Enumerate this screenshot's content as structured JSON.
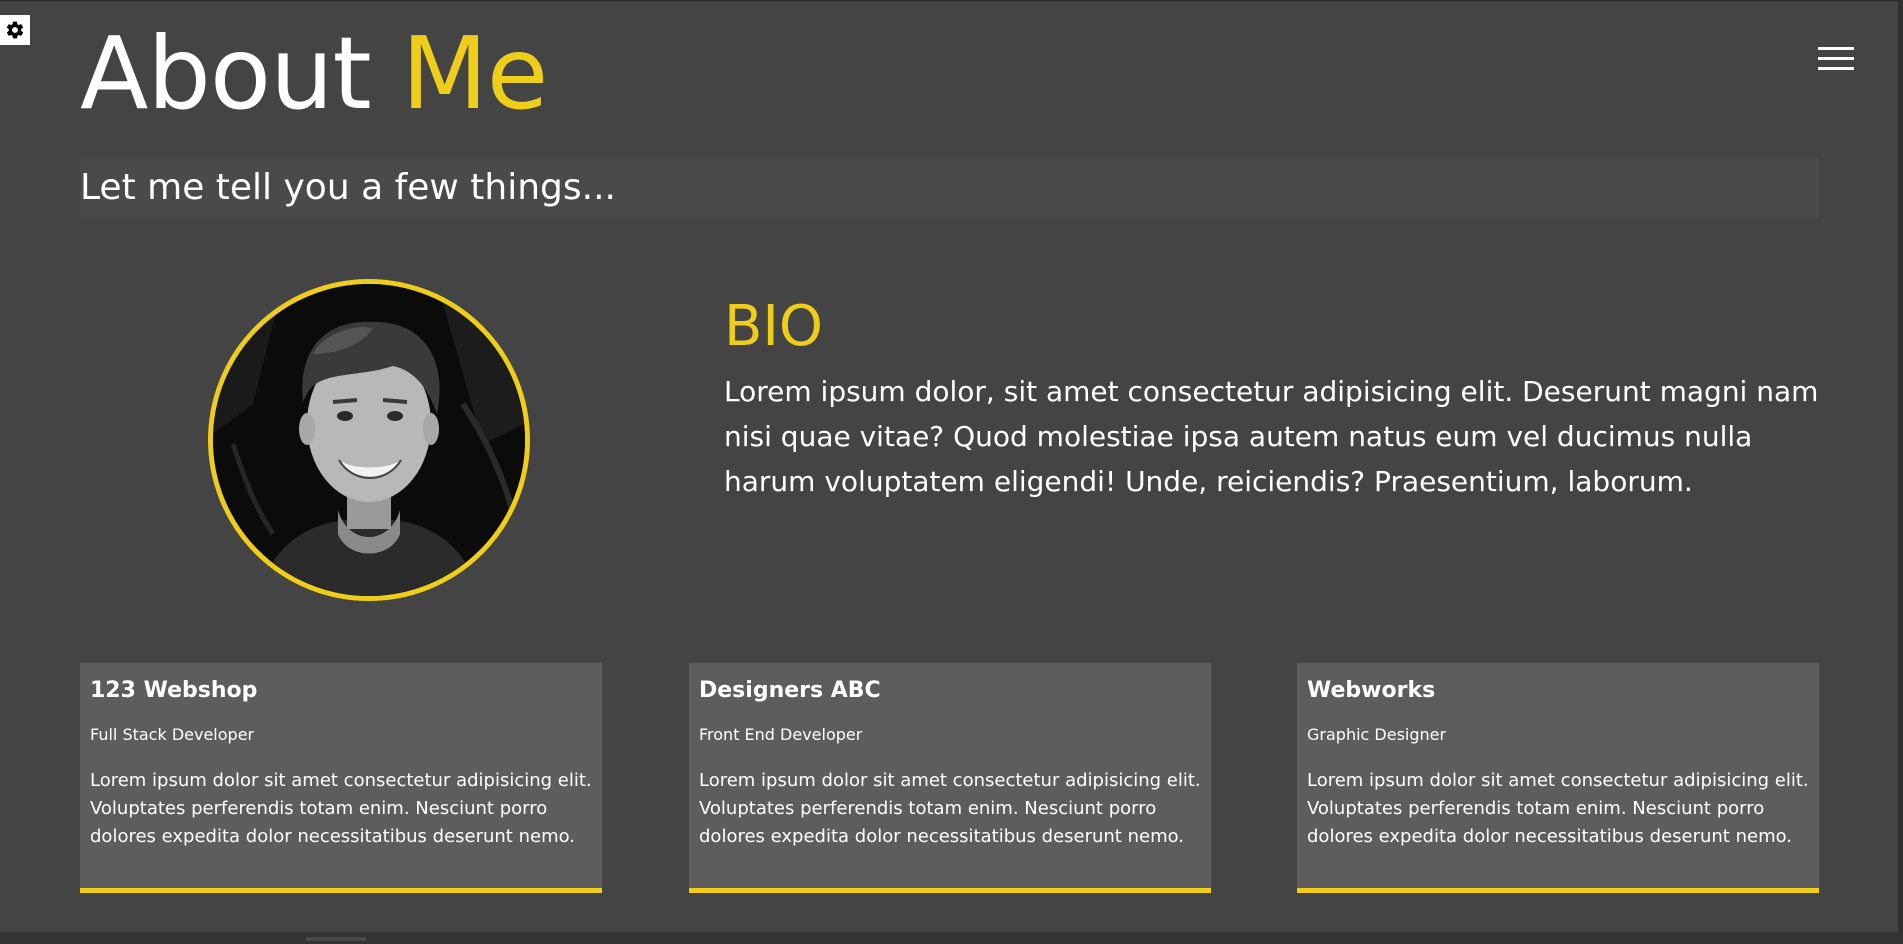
{
  "header": {
    "title_main": "About",
    "title_accent": "Me",
    "subtitle": "Let me tell you a few things..."
  },
  "icons": {
    "settings": "gear-icon",
    "menu": "hamburger-menu-icon"
  },
  "colors": {
    "accent": "#eece1a",
    "background": "#444444",
    "card_background": "#5d5d5d",
    "text": "#ffffff"
  },
  "bio": {
    "heading": "BIO",
    "text": "Lorem ipsum dolor, sit amet consectetur adipisicing elit. Deserunt magni nam nisi quae vitae? Quod molestiae ipsa autem natus eum vel ducimus nulla harum voluptatem eligendi! Unde, reiciendis? Praesentium, laborum."
  },
  "jobs": [
    {
      "company": "123 Webshop",
      "role": "Full Stack Developer",
      "description": "Lorem ipsum dolor sit amet consectetur adipisicing elit. Voluptates perferendis totam enim. Nesciunt porro dolores expedita dolor necessitatibus deserunt nemo."
    },
    {
      "company": "Designers ABC",
      "role": "Front End Developer",
      "description": "Lorem ipsum dolor sit amet consectetur adipisicing elit. Voluptates perferendis totam enim. Nesciunt porro dolores expedita dolor necessitatibus deserunt nemo."
    },
    {
      "company": "Webworks",
      "role": "Graphic Designer",
      "description": "Lorem ipsum dolor sit amet consectetur adipisicing elit. Voluptates perferendis totam enim. Nesciunt porro dolores expedita dolor necessitatibus deserunt nemo."
    }
  ]
}
